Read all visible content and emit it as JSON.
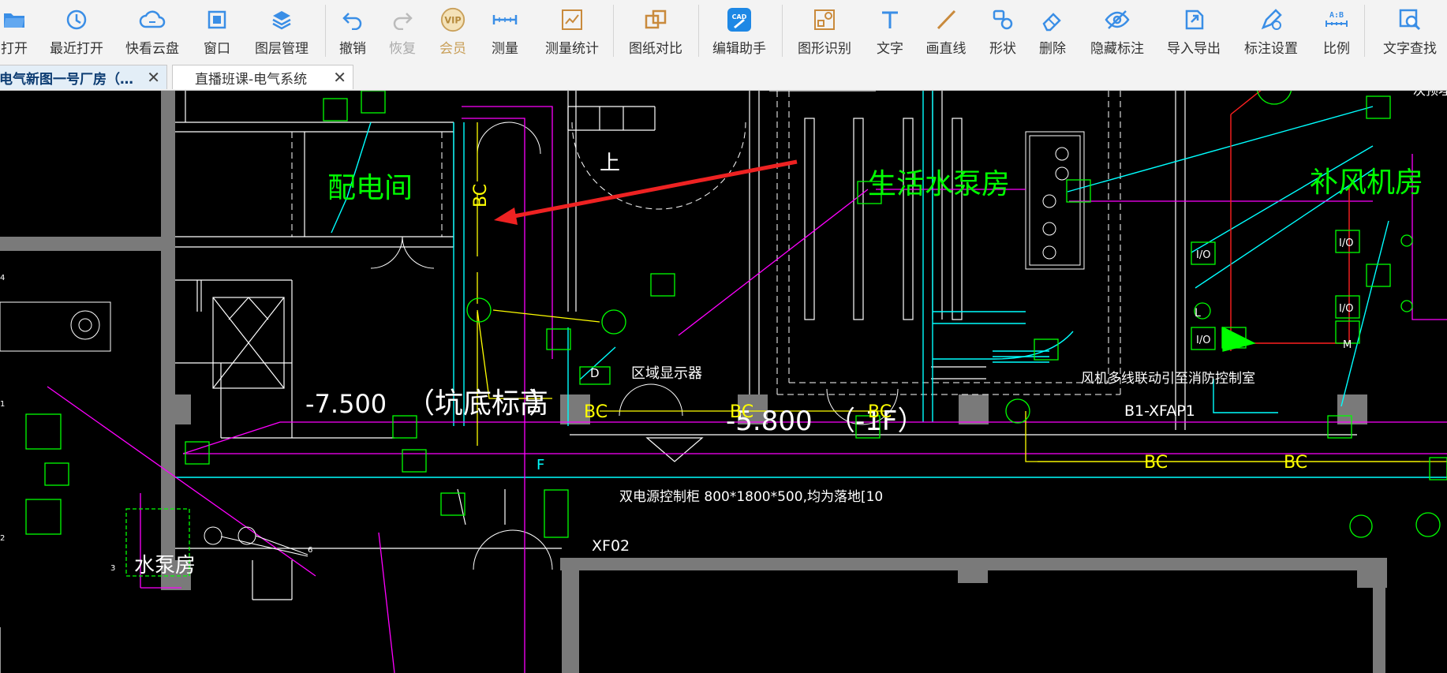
{
  "toolbar": {
    "items": [
      {
        "label": "打开",
        "icon": "folder-open-icon"
      },
      {
        "label": "最近打开",
        "icon": "clock-history-icon"
      },
      {
        "label": "快看云盘",
        "icon": "cloud-icon"
      },
      {
        "label": "窗口",
        "icon": "window-icon"
      },
      {
        "label": "图层管理",
        "icon": "layers-icon"
      },
      {
        "label": "撤销",
        "icon": "undo-icon"
      },
      {
        "label": "恢复",
        "icon": "redo-icon"
      },
      {
        "label": "会员",
        "icon": "vip-icon"
      },
      {
        "label": "测量",
        "icon": "ruler-icon"
      },
      {
        "label": "测量统计",
        "icon": "measure-stats-icon"
      },
      {
        "label": "图纸对比",
        "icon": "compare-icon"
      },
      {
        "label": "编辑助手",
        "icon": "cad-edit-icon"
      },
      {
        "label": "图形识别",
        "icon": "shape-recognition-icon"
      },
      {
        "label": "文字",
        "icon": "text-icon"
      },
      {
        "label": "画直线",
        "icon": "line-icon"
      },
      {
        "label": "形状",
        "icon": "shapes-icon"
      },
      {
        "label": "删除",
        "icon": "eraser-icon"
      },
      {
        "label": "隐藏标注",
        "icon": "hide-eye-icon"
      },
      {
        "label": "导入导出",
        "icon": "import-export-icon"
      },
      {
        "label": "标注设置",
        "icon": "annotation-settings-icon"
      },
      {
        "label": "比例",
        "icon": "scale-icon"
      },
      {
        "label": "文字查找",
        "icon": "text-search-icon"
      }
    ],
    "vip_badge": "VIP",
    "cad_badge": "CAD"
  },
  "tabs": [
    {
      "title": "电气新图一号厂房（…",
      "close": "✕"
    },
    {
      "title": "直播班课-电气系统",
      "close": "✕"
    }
  ],
  "drawing": {
    "labels": {
      "room_power": "配电间",
      "room_pump": "生活水泵房",
      "room_fan": "补风机房",
      "elev_1": "-7.500",
      "pit_note": "（坑底标高",
      "paren_close": "）",
      "elev_2": "-5.800",
      "floor": "（-1F）",
      "zone_display": "区域显示器",
      "fan_note": "风机多线联动引至消防控制室",
      "panel_id": "B1-XFAP1",
      "cabinet_note": "双电源控制柜 800*1800*500,均为落地[10",
      "xf02": "XF02",
      "bc_vertical": "BC",
      "bc_h1": "BC",
      "bc_h2": "BC",
      "bc_h3": "BC",
      "bc_h4": "BC",
      "bc_h5": "BC",
      "io1": "I/O",
      "io2": "I/O",
      "io3": "I/O",
      "io4": "I/O",
      "l_mark": "L",
      "m_mark": "M",
      "d_mark": "D",
      "f_mark": "F",
      "up": "上",
      "top_right_note": "一次预埋点位",
      "pump_room2": "水泵房",
      "num_1": "1",
      "num_2": "2",
      "num_3": "3",
      "num_6": "6",
      "num_4": "4"
    }
  },
  "colors": {
    "wall": "#7a7a7a",
    "cyan": "#00ffff",
    "magenta": "#ff00ff",
    "yellow": "#ffff00",
    "green": "#00ff00",
    "white": "#ffffff",
    "red": "#ff0000",
    "arrow": "#ee2222"
  }
}
